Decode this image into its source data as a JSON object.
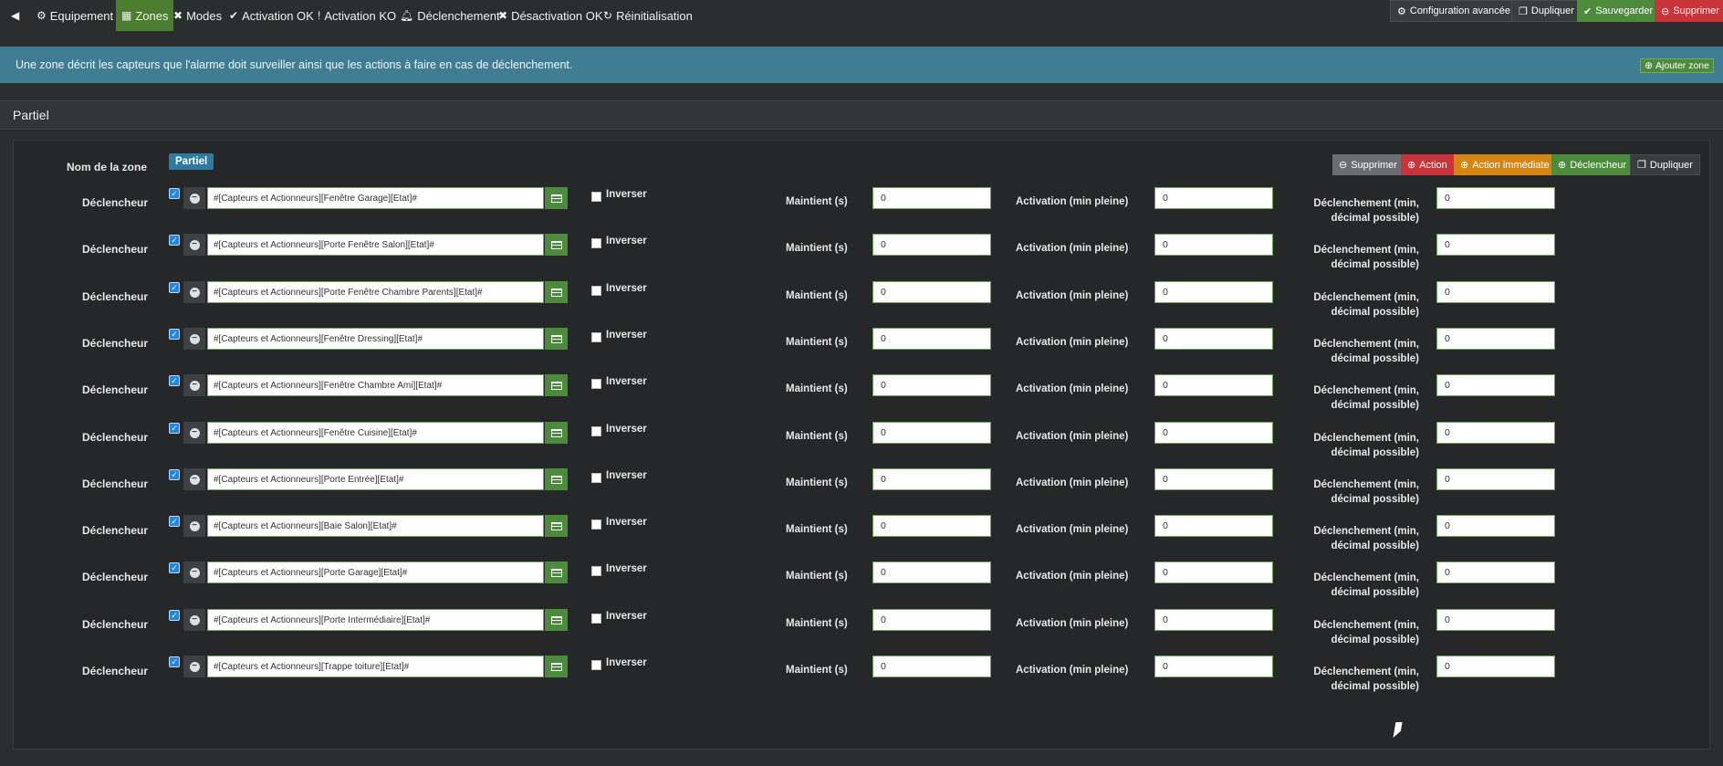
{
  "nav": {
    "back_icon": "arrow-circle-left-icon",
    "items": [
      {
        "icon": "dashboard-icon",
        "glyph": "⚙",
        "label": "Equipement"
      },
      {
        "icon": "table-icon",
        "glyph": "▦",
        "label": "Zones"
      },
      {
        "icon": "modes-icon",
        "glyph": "✖",
        "label": "Modes"
      },
      {
        "icon": "check-icon",
        "glyph": "✔",
        "label": "Activation OK"
      },
      {
        "icon": "exclamation-icon",
        "glyph": "!",
        "label": "Activation KO"
      },
      {
        "icon": "bell-icon",
        "glyph": "🔔",
        "label": "Déclenchement"
      },
      {
        "icon": "times-icon",
        "glyph": "✖",
        "label": "Désactivation OK"
      },
      {
        "icon": "refresh-icon",
        "glyph": "↻",
        "label": "Réinitialisation"
      }
    ],
    "actions": {
      "config": "Configuration avancée",
      "duplicate": "Dupliquer",
      "save": "Sauvegarder",
      "delete": "Supprimer"
    }
  },
  "info": {
    "text": "Une zone décrit les capteurs que l'alarme doit surveiller ainsi que les actions à faire en cas de déclenchement.",
    "add_zone": "Ajouter zone"
  },
  "section": {
    "title": "Partiel"
  },
  "zone": {
    "name_label": "Nom de la zone",
    "name": "Partiel",
    "buttons": {
      "delete": "Supprimer",
      "action": "Action",
      "immediate": "Action immédiate",
      "trigger": "Déclencheur",
      "duplicate": "Dupliquer"
    },
    "labels": {
      "trigger": "Déclencheur",
      "invert": "Inverser",
      "maintain": "Maintient (s)",
      "activation": "Activation (min pleine)",
      "declenchement": "Déclenchement (min, décimal possible)"
    },
    "triggers": [
      {
        "cmd": "#[Capteurs et Actionneurs][Fenêtre Garage][Etat]#",
        "maintain": "0",
        "activation": "0",
        "declenchement": "0"
      },
      {
        "cmd": "#[Capteurs et Actionneurs][Porte Fenêtre Salon][Etat]#",
        "maintain": "0",
        "activation": "0",
        "declenchement": "0"
      },
      {
        "cmd": "#[Capteurs et Actionneurs][Porte Fenêtre Chambre Parents][Etat]#",
        "maintain": "0",
        "activation": "0",
        "declenchement": "0"
      },
      {
        "cmd": "#[Capteurs et Actionneurs][Fenêtre Dressing][Etat]#",
        "maintain": "0",
        "activation": "0",
        "declenchement": "0"
      },
      {
        "cmd": "#[Capteurs et Actionneurs][Fenêtre Chambre Ami][Etat]#",
        "maintain": "0",
        "activation": "0",
        "declenchement": "0"
      },
      {
        "cmd": "#[Capteurs et Actionneurs][Fenêtre Cuisine][Etat]#",
        "maintain": "0",
        "activation": "0",
        "declenchement": "0"
      },
      {
        "cmd": "#[Capteurs et Actionneurs][Porte Entrée][Etat]#",
        "maintain": "0",
        "activation": "0",
        "declenchement": "0"
      },
      {
        "cmd": "#[Capteurs et Actionneurs][Baie Salon][Etat]#",
        "maintain": "0",
        "activation": "0",
        "declenchement": "0"
      },
      {
        "cmd": "#[Capteurs et Actionneurs][Porte Garage][Etat]#",
        "maintain": "0",
        "activation": "0",
        "declenchement": "0"
      },
      {
        "cmd": "#[Capteurs et Actionneurs][Porte Intermédiaire][Etat]#",
        "maintain": "0",
        "activation": "0",
        "declenchement": "0"
      },
      {
        "cmd": "#[Capteurs et Actionneurs][Trappe toiture][Etat]#",
        "maintain": "0",
        "activation": "0",
        "declenchement": "0"
      }
    ]
  }
}
